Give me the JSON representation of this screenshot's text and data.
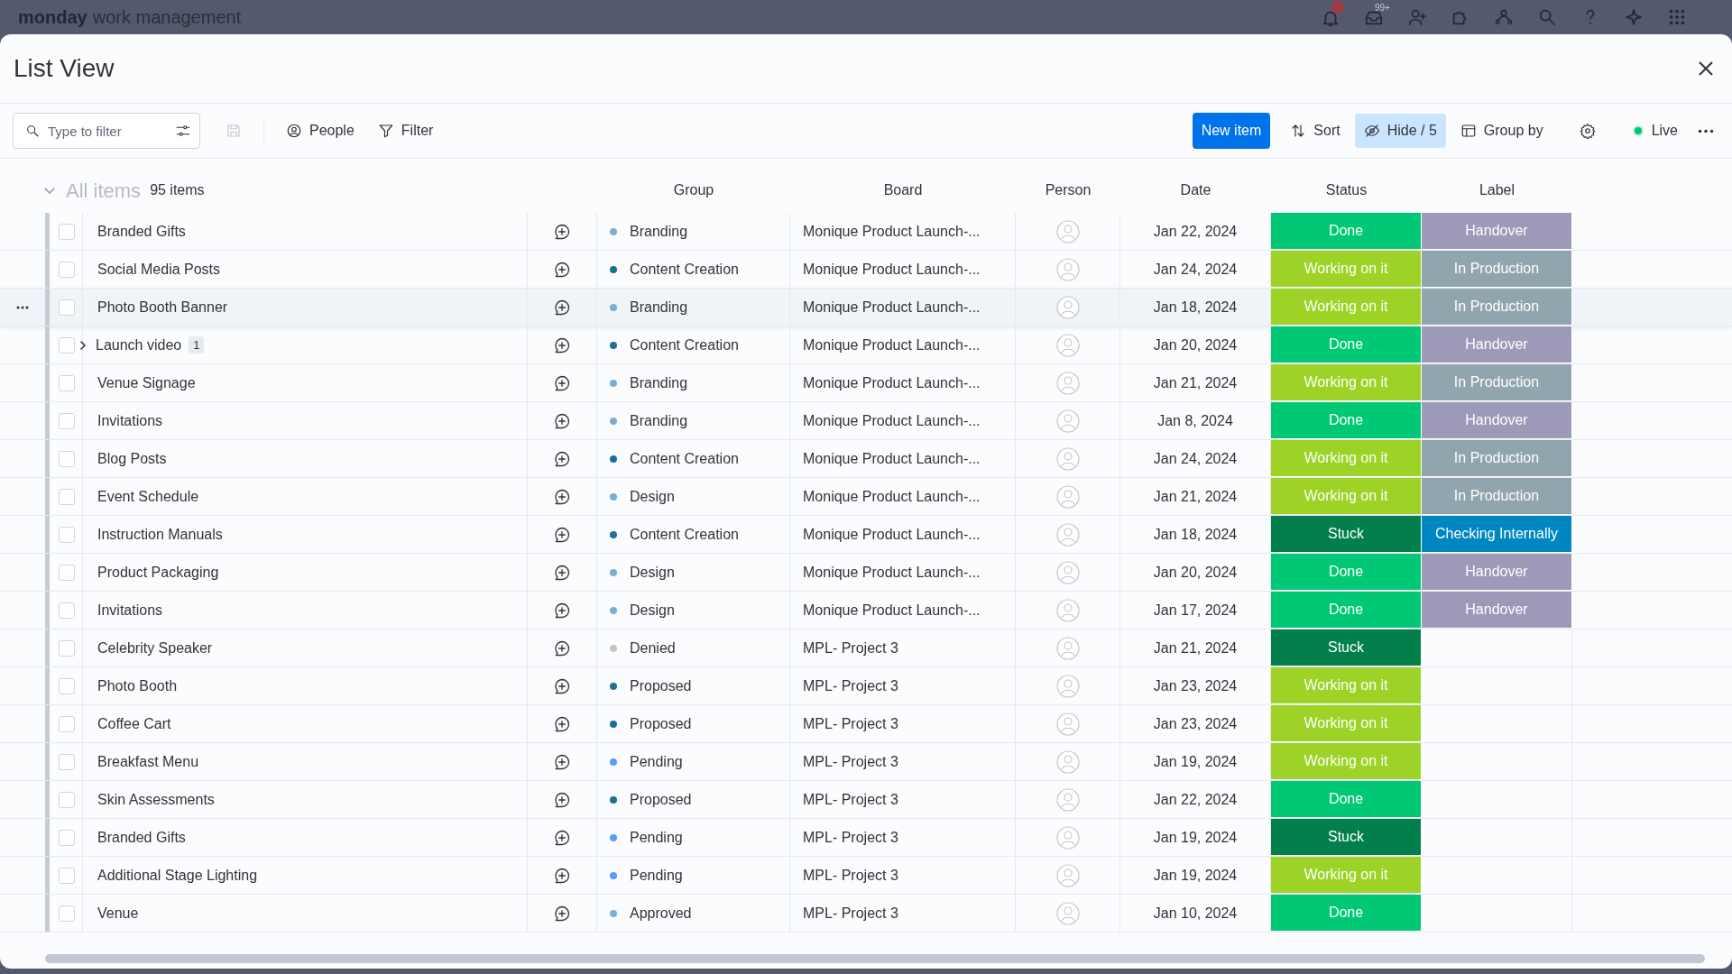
{
  "app_bar": {
    "brand": "monday",
    "product": "work management",
    "inbox_badge": "99+"
  },
  "dialog": {
    "title": "List View"
  },
  "toolbar": {
    "search": {
      "placeholder": "Type to filter"
    },
    "left_buttons": [
      {
        "kind": "people",
        "label": "People"
      },
      {
        "kind": "filter",
        "label": "Filter"
      }
    ],
    "new_item": "New item",
    "right_buttons": [
      {
        "kind": "sort",
        "label": "Sort",
        "selected": false
      },
      {
        "kind": "hide",
        "label": "Hide / 5",
        "selected": true
      },
      {
        "kind": "group",
        "label": "Group by",
        "selected": false
      }
    ],
    "live": "Live"
  },
  "group_header": {
    "title": "All items",
    "count": "95 items",
    "expanded": true
  },
  "columns": [
    "Group",
    "Board",
    "Person",
    "Date",
    "Status",
    "Label"
  ],
  "rows": [
    {
      "name": "Branded Gifts",
      "hovered": false,
      "group": {
        "label": "Branding",
        "color": "#7aaed6"
      },
      "board": "Monique Product Launch-...",
      "date": "Jan 22, 2024",
      "status": {
        "label": "Done",
        "color": "#00c875"
      },
      "label": {
        "label": "Handover",
        "color": "#9d99b9"
      }
    },
    {
      "name": "Social Media Posts",
      "hovered": false,
      "group": {
        "label": "Content Creation",
        "color": "#1f6e96"
      },
      "board": "Monique Product Launch-...",
      "date": "Jan 24, 2024",
      "status": {
        "label": "Working on it",
        "color": "#9cd326"
      },
      "label": {
        "label": "In Production",
        "color": "#91a5ae"
      }
    },
    {
      "name": "Photo Booth Banner",
      "hovered": true,
      "group": {
        "label": "Branding",
        "color": "#7aaed6"
      },
      "board": "Monique Product Launch-...",
      "date": "Jan 18, 2024",
      "status": {
        "label": "Working on it",
        "color": "#9cd326"
      },
      "label": {
        "label": "In Production",
        "color": "#91a5ae"
      }
    },
    {
      "name": "Launch video",
      "subitems": "1",
      "expanded": false,
      "hovered": false,
      "group": {
        "label": "Content Creation",
        "color": "#1f6e96"
      },
      "board": "Monique Product Launch-...",
      "date": "Jan 20, 2024",
      "status": {
        "label": "Done",
        "color": "#00c875"
      },
      "label": {
        "label": "Handover",
        "color": "#9d99b9"
      }
    },
    {
      "name": "Venue Signage",
      "hovered": false,
      "group": {
        "label": "Branding",
        "color": "#7aaed6"
      },
      "board": "Monique Product Launch-...",
      "date": "Jan 21, 2024",
      "status": {
        "label": "Working on it",
        "color": "#9cd326"
      },
      "label": {
        "label": "In Production",
        "color": "#91a5ae"
      }
    },
    {
      "name": "Invitations",
      "hovered": false,
      "group": {
        "label": "Branding",
        "color": "#7aaed6"
      },
      "board": "Monique Product Launch-...",
      "date": "Jan 8, 2024",
      "status": {
        "label": "Done",
        "color": "#00c875"
      },
      "label": {
        "label": "Handover",
        "color": "#9d99b9"
      }
    },
    {
      "name": "Blog Posts",
      "hovered": false,
      "group": {
        "label": "Content Creation",
        "color": "#1f6e96"
      },
      "board": "Monique Product Launch-...",
      "date": "Jan 24, 2024",
      "status": {
        "label": "Working on it",
        "color": "#9cd326"
      },
      "label": {
        "label": "In Production",
        "color": "#91a5ae"
      }
    },
    {
      "name": "Event Schedule",
      "hovered": false,
      "group": {
        "label": "Design",
        "color": "#7aaed6"
      },
      "board": "Monique Product Launch-...",
      "date": "Jan 21, 2024",
      "status": {
        "label": "Working on it",
        "color": "#9cd326"
      },
      "label": {
        "label": "In Production",
        "color": "#91a5ae"
      }
    },
    {
      "name": "Instruction Manuals",
      "hovered": false,
      "group": {
        "label": "Content Creation",
        "color": "#1f6e96"
      },
      "board": "Monique Product Launch-...",
      "date": "Jan 18, 2024",
      "status": {
        "label": "Stuck",
        "color": "#037f4c"
      },
      "label": {
        "label": "Checking Internally",
        "color": "#0086c0"
      }
    },
    {
      "name": "Product Packaging",
      "hovered": false,
      "group": {
        "label": "Design",
        "color": "#7aaed6"
      },
      "board": "Monique Product Launch-...",
      "date": "Jan 20, 2024",
      "status": {
        "label": "Done",
        "color": "#00c875"
      },
      "label": {
        "label": "Handover",
        "color": "#9d99b9"
      }
    },
    {
      "name": "Invitations",
      "hovered": false,
      "group": {
        "label": "Design",
        "color": "#7aaed6"
      },
      "board": "Monique Product Launch-...",
      "date": "Jan 17, 2024",
      "status": {
        "label": "Done",
        "color": "#00c875"
      },
      "label": {
        "label": "Handover",
        "color": "#9d99b9"
      }
    },
    {
      "name": "Celebrity Speaker",
      "hovered": false,
      "group": {
        "label": "Denied",
        "color": "#c4c4c4"
      },
      "board": "MPL- Project 3",
      "date": "Jan 21, 2024",
      "status": {
        "label": "Stuck",
        "color": "#037f4c"
      }
    },
    {
      "name": "Photo Booth",
      "hovered": false,
      "group": {
        "label": "Proposed",
        "color": "#1f6e96"
      },
      "board": "MPL- Project 3",
      "date": "Jan 23, 2024",
      "status": {
        "label": "Working on it",
        "color": "#9cd326"
      }
    },
    {
      "name": "Coffee Cart",
      "hovered": false,
      "group": {
        "label": "Proposed",
        "color": "#1f6e96"
      },
      "board": "MPL- Project 3",
      "date": "Jan 23, 2024",
      "status": {
        "label": "Working on it",
        "color": "#9cd326"
      }
    },
    {
      "name": "Breakfast Menu",
      "hovered": false,
      "group": {
        "label": "Pending",
        "color": "#579bfc"
      },
      "board": "MPL- Project 3",
      "date": "Jan 19, 2024",
      "status": {
        "label": "Working on it",
        "color": "#9cd326"
      }
    },
    {
      "name": "Skin Assessments",
      "hovered": false,
      "group": {
        "label": "Proposed",
        "color": "#1f6e96"
      },
      "board": "MPL- Project 3",
      "date": "Jan 22, 2024",
      "status": {
        "label": "Done",
        "color": "#00c875"
      }
    },
    {
      "name": "Branded Gifts",
      "hovered": false,
      "group": {
        "label": "Pending",
        "color": "#579bfc"
      },
      "board": "MPL- Project 3",
      "date": "Jan 19, 2024",
      "status": {
        "label": "Stuck",
        "color": "#037f4c"
      }
    },
    {
      "name": "Additional Stage Lighting",
      "hovered": false,
      "group": {
        "label": "Pending",
        "color": "#579bfc"
      },
      "board": "MPL- Project 3",
      "date": "Jan 19, 2024",
      "status": {
        "label": "Working on it",
        "color": "#9cd326"
      }
    },
    {
      "name": "Venue",
      "hovered": false,
      "group": {
        "label": "Approved",
        "color": "#7aaed6"
      },
      "board": "MPL- Project 3",
      "date": "Jan 10, 2024",
      "status": {
        "label": "Done",
        "color": "#00c875"
      }
    }
  ]
}
